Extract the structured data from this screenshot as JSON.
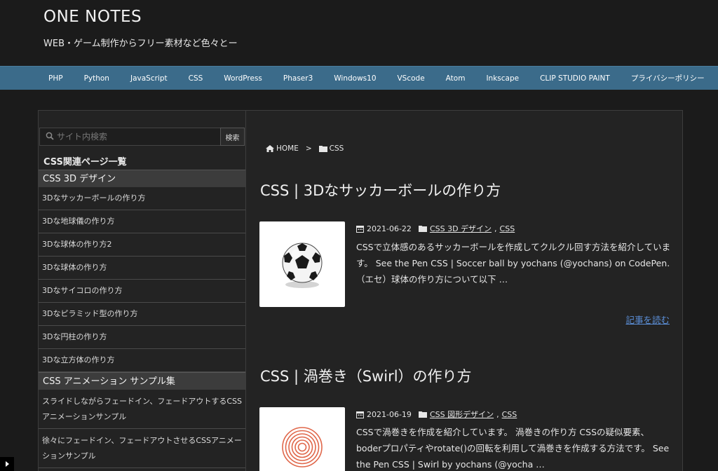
{
  "header": {
    "title": "ONE NOTES",
    "description": "WEB・ゲーム制作からフリー素材など色々とー"
  },
  "nav": {
    "items": [
      "PHP",
      "Python",
      "JavaScript",
      "CSS",
      "WordPress",
      "Phaser3",
      "Windows10",
      "VScode",
      "Atom",
      "Inkscape",
      "CLIP STUDIO PAINT",
      "プライバシーポリシー"
    ]
  },
  "sidebar": {
    "search": {
      "placeholder": "サイト内検索",
      "button": "検索"
    },
    "heading": "CSS関連ページ一覧",
    "category1": "CSS 3D デザイン",
    "links1": [
      "3Dなサッカーボールの作り方",
      "3Dな地球儀の作り方",
      "3Dな球体の作り方2",
      "3Dな球体の作り方",
      "3Dなサイコロの作り方",
      "3Dなピラミッド型の作り方",
      "3Dな円柱の作り方",
      "3Dな立方体の作り方"
    ],
    "category2": "CSS アニメーション サンプル集",
    "links2": [
      "スライドしながらフェードイン、フェードアウトするCSSアニメーションサンプル",
      "徐々にフェードイン、フェードアウトさせるCSSアニメーションサンプル"
    ]
  },
  "breadcrumb": {
    "home": "HOME",
    "sep": ">",
    "current": "CSS"
  },
  "posts": [
    {
      "title": "CSS | 3Dなサッカーボールの作り方",
      "date": "2021-06-22",
      "cat1": "CSS 3D デザイン",
      "cat2": "CSS",
      "comma": ",",
      "excerpt": "CSSで立体感のあるサッカーボールを作成してクルクル回す方法を紹介しています。 See the Pen CSS | Soccer ball by yochans (@yochans) on CodePen. （エセ）球体の作り方について以下 …",
      "readmore": "記事を読む"
    },
    {
      "title": "CSS | 渦巻き（Swirl）の作り方",
      "date": "2021-06-19",
      "cat1": "CSS 図形デザイン",
      "cat2": "CSS",
      "comma": ",",
      "excerpt": "CSSで渦巻きを作成を紹介しています。 渦巻きの作り方 CSSの疑似要素、boderプロパティやrotate()の回転を利用して渦巻きを作成する方法です。 See the Pen CSS | Swirl by yochans (@yocha …"
    }
  ],
  "colors": {
    "background": "#1b1b1b",
    "nav": "#3b6b8a",
    "link": "#5b8ed6",
    "swirl": "#e0674a"
  }
}
